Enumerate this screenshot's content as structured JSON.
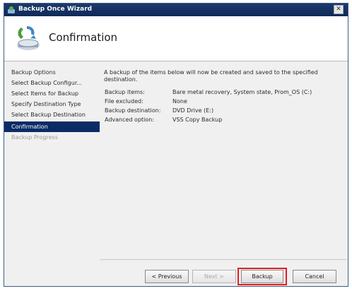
{
  "window": {
    "title": "Backup Once Wizard",
    "close_glyph": "✕"
  },
  "header": {
    "title": "Confirmation",
    "icon": "backup-wizard-icon"
  },
  "nav": {
    "items": [
      {
        "label": "Backup Options",
        "state": "normal"
      },
      {
        "label": "Select Backup Configur...",
        "state": "normal"
      },
      {
        "label": "Select Items for Backup",
        "state": "normal"
      },
      {
        "label": "Specify Destination Type",
        "state": "normal"
      },
      {
        "label": "Select Backup Destination",
        "state": "normal"
      },
      {
        "label": "Confirmation",
        "state": "active"
      },
      {
        "label": "Backup Progress",
        "state": "disabled"
      }
    ]
  },
  "content": {
    "intro": "A backup of the items below will now be created and saved to the specified destination.",
    "details": [
      {
        "label": "Backup items:",
        "value": "Bare metal recovery, System state, Prom_OS (C:)"
      },
      {
        "label": "File excluded:",
        "value": "None"
      },
      {
        "label": "Backup destination:",
        "value": "DVD Drive (E:)"
      },
      {
        "label": "Advanced option:",
        "value": "VSS Copy Backup"
      }
    ]
  },
  "buttons": {
    "previous": "< Previous",
    "next": "Next >",
    "backup": "Backup",
    "cancel": "Cancel"
  },
  "colors": {
    "title_bar": "#0e2a58",
    "active_nav": "#0b2b66",
    "highlight": "#e01c24"
  }
}
